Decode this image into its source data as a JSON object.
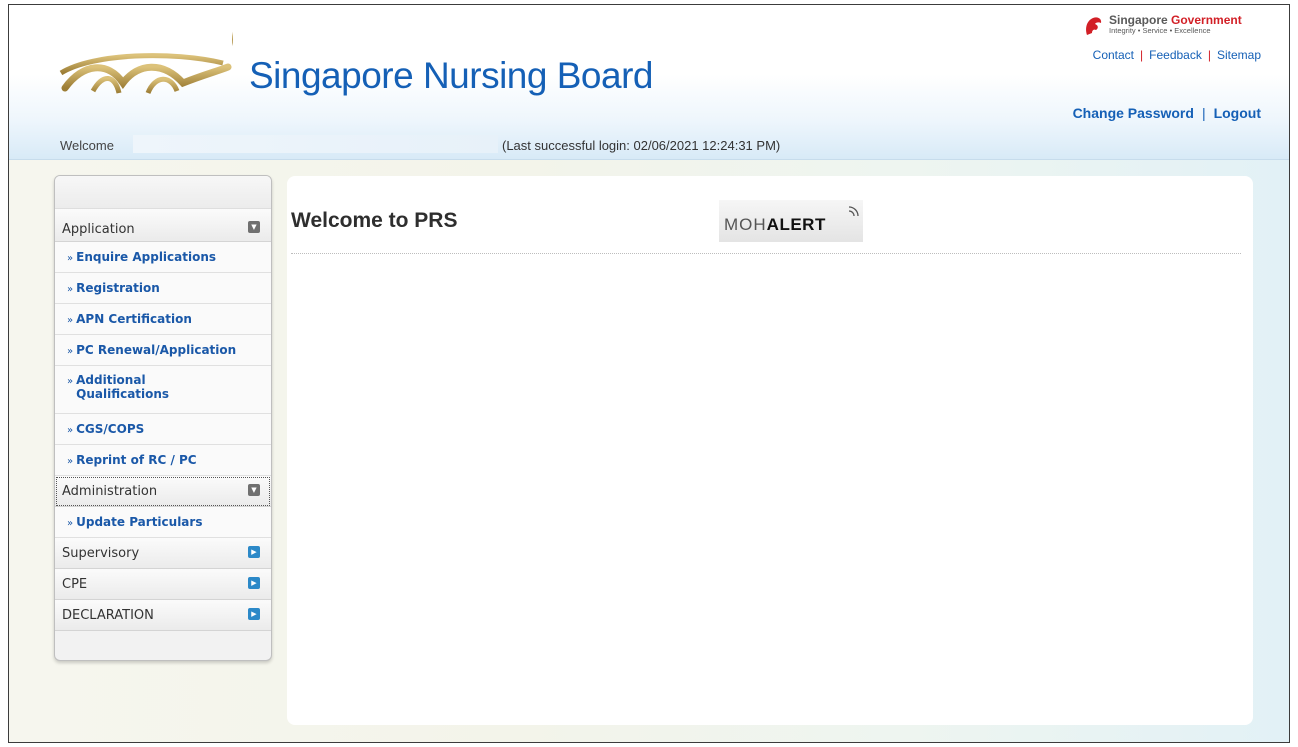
{
  "header": {
    "site_title": "Singapore Nursing Board",
    "gov_name_a": "Singapore ",
    "gov_name_b": "Government",
    "gov_tagline": "Integrity • Service • Excellence",
    "top_links": [
      "Contact",
      "Feedback",
      "Sitemap"
    ],
    "user_links": [
      "Change Password",
      "Logout"
    ],
    "welcome_label": "Welcome",
    "last_login": "(Last successful login: 02/06/2021 12:24:31 PM)"
  },
  "sidebar": {
    "application": {
      "label": "Application",
      "items": [
        "Enquire Applications",
        "Registration",
        "APN Certification",
        "PC Renewal/Application",
        "Additional Qualifications",
        "CGS/COPS",
        "Reprint of RC / PC"
      ]
    },
    "administration": {
      "label": "Administration",
      "items": [
        "Update Particulars"
      ]
    },
    "supervisory": "Supervisory",
    "cpe": "CPE",
    "declaration": "DECLARATION"
  },
  "main": {
    "title": "Welcome to PRS",
    "moh_a": "MOH",
    "moh_b": "ALERT"
  },
  "colors": {
    "brand_blue": "#1560b6",
    "gov_red": "#d21f26",
    "toggle_blue": "#2c89c8"
  }
}
